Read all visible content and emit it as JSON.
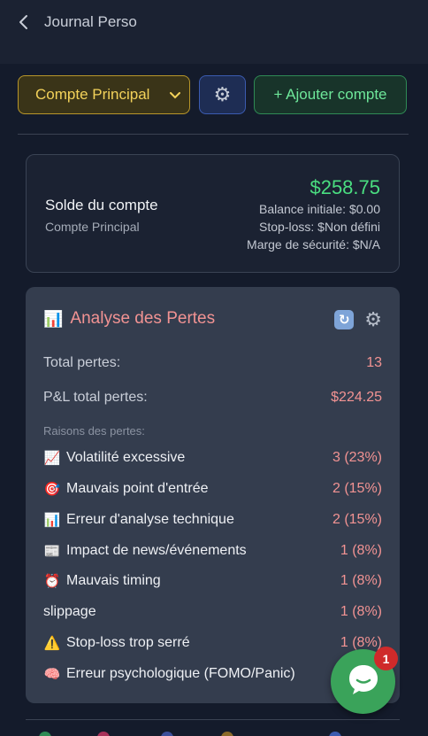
{
  "header": {
    "title": "Journal Perso"
  },
  "toolbar": {
    "account_selected": "Compte Principal",
    "add_label": "+ Ajouter compte"
  },
  "balance": {
    "title": "Solde du compte",
    "account_name": "Compte Principal",
    "amount": "$258.75",
    "initial": "Balance initiale: $0.00",
    "stop_loss": "Stop-loss: $Non défini",
    "safety_margin": "Marge de sécurité: $N/A"
  },
  "losses": {
    "title": "Analyse des Pertes",
    "title_emoji": "📊",
    "total_label": "Total pertes:",
    "total_value": "13",
    "pnl_label": "P&L total pertes:",
    "pnl_value": "$224.25",
    "reasons_label": "Raisons des pertes:",
    "reasons": [
      {
        "emoji": "📈",
        "label": "Volatilité excessive",
        "value": "3 (23%)"
      },
      {
        "emoji": "🎯",
        "label": "Mauvais point d'entrée",
        "value": "2 (15%)"
      },
      {
        "emoji": "📊",
        "label": "Erreur d'analyse technique",
        "value": "2 (15%)"
      },
      {
        "emoji": "📰",
        "label": "Impact de news/événements",
        "value": "1 (8%)"
      },
      {
        "emoji": "⏰",
        "label": "Mauvais timing",
        "value": "1 (8%)"
      },
      {
        "emoji": "",
        "label": "slippage",
        "value": "1 (8%)"
      },
      {
        "emoji": "⚠️",
        "label": "Stop-loss trop serré",
        "value": "1 (8%)"
      },
      {
        "emoji": "🧠",
        "label": "Erreur psychologique (FOMO/Panic)",
        "value": ""
      }
    ]
  },
  "chat": {
    "badge_count": "1"
  },
  "colors": {
    "accent_yellow": "#f3d25a",
    "accent_green": "#4ade80",
    "loss_red": "#f29393",
    "chat_green": "#3aa35a"
  }
}
